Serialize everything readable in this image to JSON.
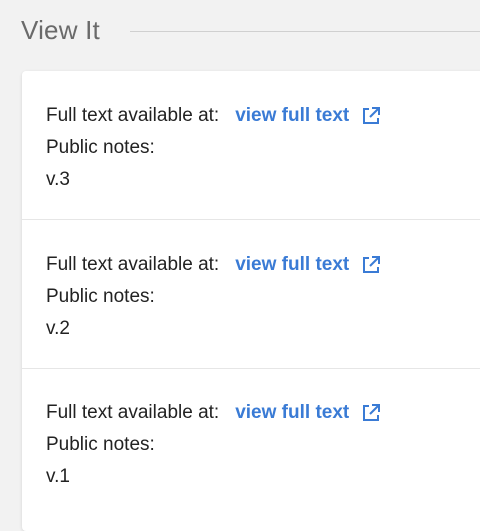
{
  "section": {
    "title": "View It"
  },
  "entries": [
    {
      "available_label": "Full text available at:",
      "link_label": "view full text",
      "notes_label": "Public notes:",
      "note_value": "v.3"
    },
    {
      "available_label": "Full text available at:",
      "link_label": "view full text",
      "notes_label": "Public notes:",
      "note_value": "v.2"
    },
    {
      "available_label": "Full text available at:",
      "link_label": "view full text",
      "notes_label": "Public notes:",
      "note_value": "v.1"
    }
  ],
  "colors": {
    "link": "#3a7bd5",
    "background": "#f2f2f2",
    "card": "#ffffff",
    "title": "#6a6a6a"
  },
  "icons": {
    "external_link": "external-link-icon"
  }
}
